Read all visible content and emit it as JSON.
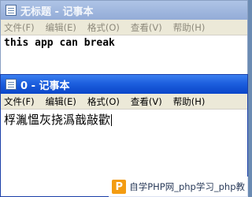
{
  "window_back": {
    "title": "无标题 - 记事本",
    "menu": [
      "文件(F)",
      "编辑(E)",
      "格式(O)",
      "查看(V)",
      "帮助(H)"
    ],
    "content": "this app can break"
  },
  "window_front": {
    "title": "0 - 记事本",
    "menu": [
      "文件(F)",
      "编辑(E)",
      "格式(O)",
      "查看(V)",
      "帮助(H)"
    ],
    "content": "桴湚慍灰挠潙戠敲歡"
  },
  "watermark": {
    "logo": "P",
    "text": "自学PHP网_php学习_php教"
  }
}
